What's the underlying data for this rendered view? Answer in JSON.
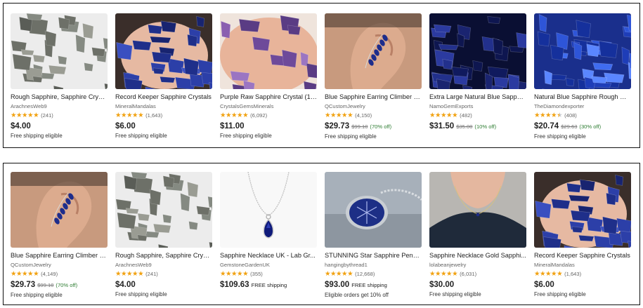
{
  "top": [
    {
      "title": "Rough Sapphire, Sapphire Cryst...",
      "shop": "ArachnesWeb9",
      "rating": 5,
      "count": "(241)",
      "price": "$4.00",
      "orig": "",
      "discount": "",
      "ship_inline": "",
      "ship": "Free shipping eligible",
      "thumb": "rough-grey-crystals"
    },
    {
      "title": "Record Keeper Sapphire Crystals",
      "shop": "MineralMandalas",
      "rating": 5,
      "count": "(1,643)",
      "price": "$6.00",
      "orig": "",
      "discount": "",
      "ship_inline": "",
      "ship": "Free shipping eligible",
      "thumb": "blue-in-palm"
    },
    {
      "title": "Purple Raw Sapphire Crystal (10...",
      "shop": "CrystalsGemsMinerals",
      "rating": 5,
      "count": "(6,092)",
      "price": "$11.00",
      "orig": "",
      "discount": "",
      "ship_inline": "",
      "ship": "Free shipping eligible",
      "thumb": "purple-on-fingers"
    },
    {
      "title": "Blue Sapphire Earring Climber / ...",
      "shop": "QCustomJewelry",
      "rating": 5,
      "count": "(4,150)",
      "price": "$29.73",
      "orig": "$99.10",
      "discount": "(70% off)",
      "ship_inline": "",
      "ship": "Free shipping eligible",
      "thumb": "ear-climber"
    },
    {
      "title": "Extra Large Natural Blue Sapphi...",
      "shop": "NamoGemExports",
      "rating": 5,
      "count": "(482)",
      "price": "$31.50",
      "orig": "$35.00",
      "discount": "(10% off)",
      "ship_inline": "",
      "ship": "",
      "thumb": "dark-blue-pile"
    },
    {
      "title": "Natural Blue Sapphire Rough Ge...",
      "shop": "TheDiamondexporter",
      "rating": 4.5,
      "count": "(408)",
      "price": "$20.74",
      "orig": "$29.63",
      "discount": "(30% off)",
      "ship_inline": "",
      "ship": "Free shipping eligible",
      "thumb": "bright-blue-pile"
    }
  ],
  "bottom": [
    {
      "title": "Blue Sapphire Earring Climber / ...",
      "shop": "QCustomJewelry",
      "rating": 5,
      "count": "(4,149)",
      "price": "$29.73",
      "orig": "$99.10",
      "discount": "(70% off)",
      "ship_inline": "",
      "ship": "Free shipping eligible",
      "thumb": "ear-climber"
    },
    {
      "title": "Rough Sapphire, Sapphire Cryst...",
      "shop": "ArachnesWeb9",
      "rating": 5,
      "count": "(241)",
      "price": "$4.00",
      "orig": "",
      "discount": "",
      "ship_inline": "",
      "ship": "Free shipping eligible",
      "thumb": "rough-grey-crystals"
    },
    {
      "title": "Sapphire Necklace UK - Lab Gr...",
      "shop": "GemstoneGardenUK",
      "rating": 5,
      "count": "(355)",
      "price": "$109.63",
      "orig": "",
      "discount": "",
      "ship_inline": "FREE shipping",
      "ship": "",
      "thumb": "teardrop-necklace"
    },
    {
      "title": "STUNNING Star Sapphire Penda...",
      "shop": "hangingbythread1",
      "rating": 5,
      "count": "(12,668)",
      "price": "$93.00",
      "orig": "",
      "discount": "",
      "ship_inline": "FREE shipping",
      "ship": "Eligible orders get 10% off",
      "thumb": "star-sapphire"
    },
    {
      "title": "Sapphire Necklace Gold Sapphi...",
      "shop": "lolabeanjewelry",
      "rating": 5,
      "count": "(6,031)",
      "price": "$30.00",
      "orig": "",
      "discount": "",
      "ship_inline": "",
      "ship": "Free shipping eligible",
      "thumb": "necklace-on-neck"
    },
    {
      "title": "Record Keeper Sapphire Crystals",
      "shop": "MineralMandalas",
      "rating": 5,
      "count": "(1,643)",
      "price": "$6.00",
      "orig": "",
      "discount": "",
      "ship_inline": "",
      "ship": "Free shipping eligible",
      "thumb": "blue-in-palm"
    }
  ],
  "colors": {
    "star": "#f1a10f",
    "discount": "#2e7d32",
    "border": "#111111"
  }
}
